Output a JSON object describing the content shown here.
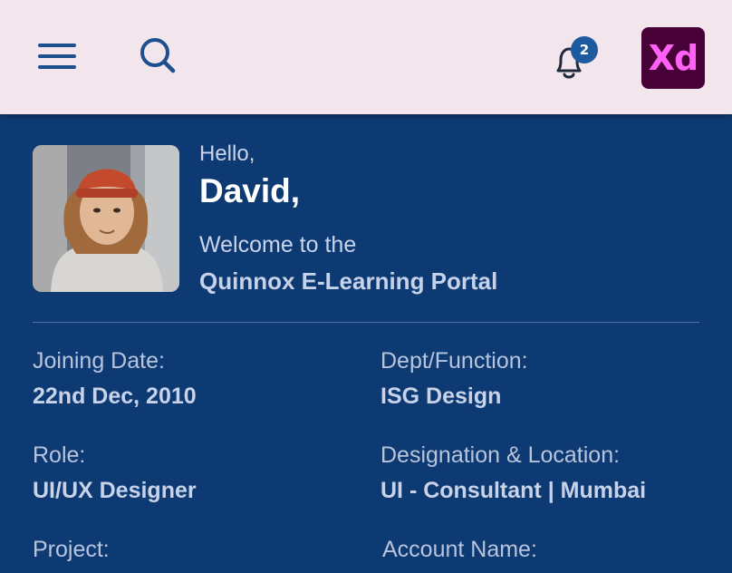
{
  "header": {
    "notification_count": "2",
    "app_badge": "Xd",
    "colors": {
      "bar": "#f2e6ec",
      "icons": "#1d4f8f",
      "badge": "#1d5a9f",
      "xd_bg": "#470137",
      "xd_text": "#ff61f6"
    }
  },
  "profile": {
    "hello": "Hello,",
    "name": "David,",
    "welcome": "Welcome to the",
    "portal": "Quinnox E-Learning Portal"
  },
  "details": {
    "joining_label": "Joining Date:",
    "joining_value": "22nd Dec, 2010",
    "dept_label": "Dept/Function:",
    "dept_value": "ISG Design",
    "role_label": "Role:",
    "role_value": "UI/UX Designer",
    "designation_label": "Designation & Location:",
    "designation_value": "UI - Consultant | Mumbai",
    "project_label": "Project:",
    "account_label": "Account Name:"
  },
  "theme": {
    "background": "#0e3a73"
  }
}
